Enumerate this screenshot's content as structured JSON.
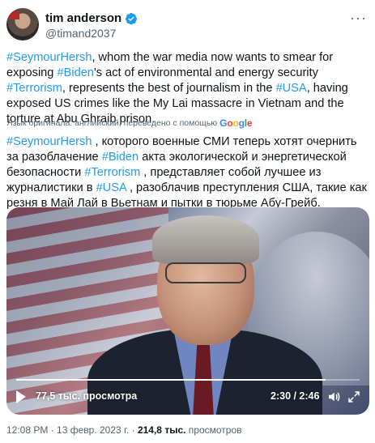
{
  "author": {
    "name": "tim anderson",
    "handle": "@timand2037"
  },
  "tweet": {
    "segments": [
      {
        "text": "#SeymourHersh",
        "tag": true
      },
      {
        "text": ", whom the war media now wants to smear for exposing ",
        "tag": false
      },
      {
        "text": "#Biden",
        "tag": true
      },
      {
        "text": "'s act of environmental and energy security ",
        "tag": false
      },
      {
        "text": "#Terrorism",
        "tag": true
      },
      {
        "text": ", represents the best of journalism in the ",
        "tag": false
      },
      {
        "text": "#USA",
        "tag": true
      },
      {
        "text": ", having exposed US crimes like the My Lai massacre in Vietnam and the torture at Abu Ghraib prison.",
        "tag": false
      }
    ]
  },
  "translation_note": {
    "label": "Язык оригинала: английский, переведено с помощью",
    "provider": "Google"
  },
  "translation": {
    "segments": [
      {
        "text": "#SeymourHersh",
        "tag": true
      },
      {
        "text": " , которого военные СМИ теперь хотят очернить за разоблачение ",
        "tag": false
      },
      {
        "text": "#Biden",
        "tag": true
      },
      {
        "text": " акта экологической и энергетической безопасности ",
        "tag": false
      },
      {
        "text": "#Terrorism",
        "tag": true
      },
      {
        "text": " , представляет собой лучшее из журналистики в ",
        "tag": false
      },
      {
        "text": "#USA",
        "tag": true
      },
      {
        "text": " , разоблачив преступления США, такие как резня в Май Лай в Вьетнам и пытки в тюрьме Абу-Грейб.",
        "tag": false
      }
    ]
  },
  "video": {
    "views": "77,5 тыс. просмотра",
    "timecode": "2:30 / 2:46",
    "progress": 0.9
  },
  "meta": {
    "time": "12:08 PM",
    "separator1": " · ",
    "date": "13 февр. 2023 г.",
    "separator2": " · ",
    "views_count": "214,8 тыс.",
    "views_label": " просмотров"
  },
  "colors": {
    "link": "#1d9bf0",
    "verified": "#1d9bf0",
    "text": "#0f1419",
    "muted": "#536471"
  },
  "icons": [
    "verified-badge-icon",
    "more-icon",
    "play-icon",
    "sound-icon",
    "fullscreen-icon"
  ]
}
